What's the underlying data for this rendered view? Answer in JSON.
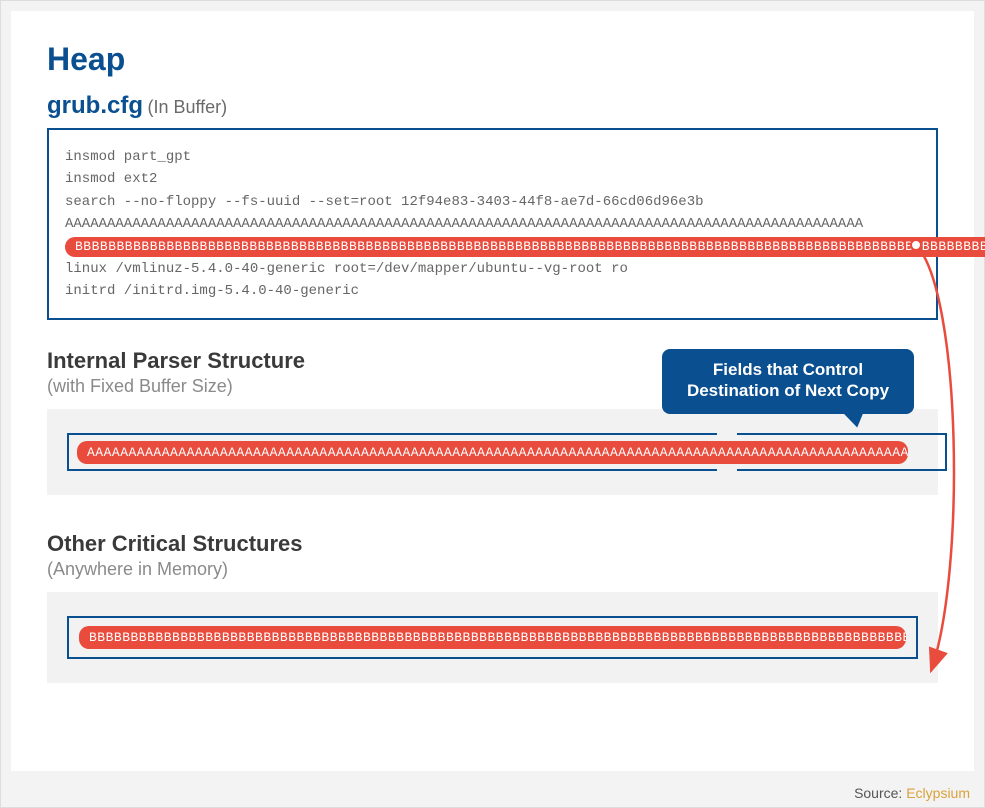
{
  "title": "Heap",
  "buffer": {
    "label": "grub.cfg",
    "sublabel": "(In Buffer)",
    "code_lines": [
      "insmod part_gpt",
      "insmod ext2",
      "search --no-floppy --fs-uuid --set=root 12f94e83-3403-44f8-ae7d-66cd06d96e3b",
      "AAAAAAAAAAAAAAAAAAAAAAAAAAAAAAAAAAAAAAAAAAAAAAAAAAAAAAAAAAAAAAAAAAAAAAAAAAAAAAAAAAAAAAAAAAAAAAA"
    ],
    "overflow_line": "BBBBBBBBBBBBBBBBBBBBBBBBBBBBBBBBBBBBBBBBBBBBBBBBBBBBBBBBBBBBBBBBBBBBBBBBBBBBBBBBBBBBBBBBBBBBBBBBBBBBBBBBBBBBBBBBBB",
    "code_lines_after": [
      "linux   /vmlinuz-5.4.0-40-generic root=/dev/mapper/ubuntu--vg-root ro",
      "initrd  /initrd.img-5.4.0-40-generic"
    ]
  },
  "parser": {
    "title": "Internal Parser Structure",
    "subtitle": "(with Fixed Buffer Size)",
    "a_string": "AAAAAAAAAAAAAAAAAAAAAAAAAAAAAAAAAAAAAAAAAAAAAAAAAAAAAAAAAAAAAAAAAAAAAAAAAAAAAAAAAAAAAAAAAAAAAAAAAAAAAAAAAAAAAAAAAAAAAAAAAAAAAAAAAAAAA"
  },
  "other": {
    "title": "Other Critical Structures",
    "subtitle": "(Anywhere in Memory)",
    "b_string": "BBBBBBBBBBBBBBBBBBBBBBBBBBBBBBBBBBBBBBBBBBBBBBBBBBBBBBBBBBBBBBBBBBBBBBBBBBBBBBBBBBBBBBBBBBBBBBBBBBBBBBBBBBBBBBBBBBBBBBBBBBB"
  },
  "callout": {
    "line1": "Fields that Control",
    "line2": "Destination of Next Copy"
  },
  "source": {
    "prefix": "Source: ",
    "link": "Eclypsium"
  }
}
